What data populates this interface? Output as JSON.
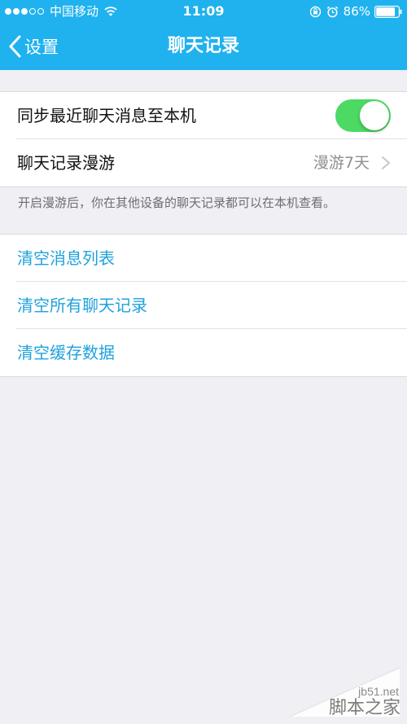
{
  "status_bar": {
    "signal_dots_filled": 3,
    "signal_dots_total": 5,
    "carrier": "中国移动",
    "time": "11:09",
    "battery_percent": "86%",
    "battery_level": 0.86
  },
  "nav": {
    "back_label": "设置",
    "title": "聊天记录"
  },
  "settings_group": {
    "sync_row": {
      "label": "同步最近聊天消息至本机",
      "toggle_on": true
    },
    "roaming_row": {
      "label": "聊天记录漫游",
      "value": "漫游7天"
    },
    "footnote": "开启漫游后，你在其他设备的聊天记录都可以在本机查看。"
  },
  "actions_group": {
    "items": [
      {
        "label": "清空消息列表"
      },
      {
        "label": "清空所有聊天记录"
      },
      {
        "label": "清空缓存数据"
      }
    ]
  },
  "watermark": {
    "site": "jb51.net",
    "brand": "脚本之家"
  },
  "colors": {
    "nav_background": "#1fb2ef",
    "page_background": "#efeff4",
    "toggle_on": "#4cd964",
    "link_text": "#1ea2dc"
  },
  "icons": {
    "back": "chevron-left-icon",
    "roaming_arrow": "chevron-right-icon",
    "wifi": "wifi-icon",
    "orientation_lock": "orientation-lock-icon",
    "alarm": "alarm-icon",
    "battery": "battery-icon"
  }
}
